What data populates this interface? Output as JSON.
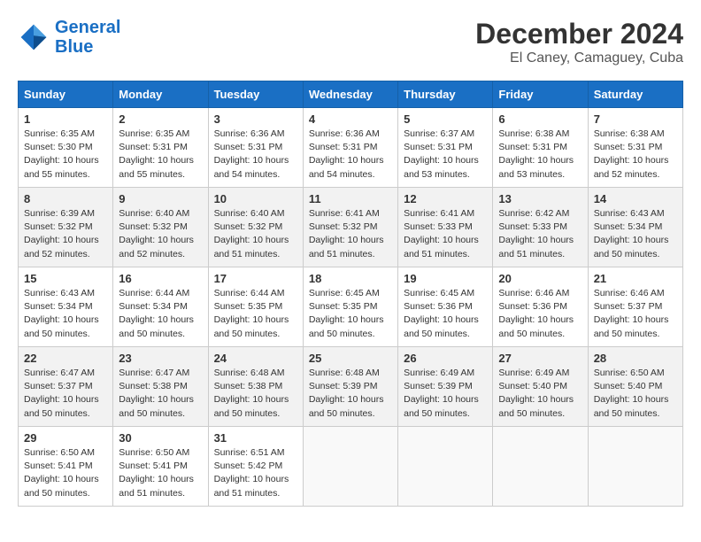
{
  "header": {
    "logo_line1": "General",
    "logo_line2": "Blue",
    "month": "December 2024",
    "location": "El Caney, Camaguey, Cuba"
  },
  "weekdays": [
    "Sunday",
    "Monday",
    "Tuesday",
    "Wednesday",
    "Thursday",
    "Friday",
    "Saturday"
  ],
  "weeks": [
    [
      {
        "day": 1,
        "rise": "6:35 AM",
        "set": "5:30 PM",
        "hours": "10 hours and 55 minutes."
      },
      {
        "day": 2,
        "rise": "6:35 AM",
        "set": "5:31 PM",
        "hours": "10 hours and 55 minutes."
      },
      {
        "day": 3,
        "rise": "6:36 AM",
        "set": "5:31 PM",
        "hours": "10 hours and 54 minutes."
      },
      {
        "day": 4,
        "rise": "6:36 AM",
        "set": "5:31 PM",
        "hours": "10 hours and 54 minutes."
      },
      {
        "day": 5,
        "rise": "6:37 AM",
        "set": "5:31 PM",
        "hours": "10 hours and 53 minutes."
      },
      {
        "day": 6,
        "rise": "6:38 AM",
        "set": "5:31 PM",
        "hours": "10 hours and 53 minutes."
      },
      {
        "day": 7,
        "rise": "6:38 AM",
        "set": "5:31 PM",
        "hours": "10 hours and 52 minutes."
      }
    ],
    [
      {
        "day": 8,
        "rise": "6:39 AM",
        "set": "5:32 PM",
        "hours": "10 hours and 52 minutes."
      },
      {
        "day": 9,
        "rise": "6:40 AM",
        "set": "5:32 PM",
        "hours": "10 hours and 52 minutes."
      },
      {
        "day": 10,
        "rise": "6:40 AM",
        "set": "5:32 PM",
        "hours": "10 hours and 51 minutes."
      },
      {
        "day": 11,
        "rise": "6:41 AM",
        "set": "5:32 PM",
        "hours": "10 hours and 51 minutes."
      },
      {
        "day": 12,
        "rise": "6:41 AM",
        "set": "5:33 PM",
        "hours": "10 hours and 51 minutes."
      },
      {
        "day": 13,
        "rise": "6:42 AM",
        "set": "5:33 PM",
        "hours": "10 hours and 51 minutes."
      },
      {
        "day": 14,
        "rise": "6:43 AM",
        "set": "5:34 PM",
        "hours": "10 hours and 50 minutes."
      }
    ],
    [
      {
        "day": 15,
        "rise": "6:43 AM",
        "set": "5:34 PM",
        "hours": "10 hours and 50 minutes."
      },
      {
        "day": 16,
        "rise": "6:44 AM",
        "set": "5:34 PM",
        "hours": "10 hours and 50 minutes."
      },
      {
        "day": 17,
        "rise": "6:44 AM",
        "set": "5:35 PM",
        "hours": "10 hours and 50 minutes."
      },
      {
        "day": 18,
        "rise": "6:45 AM",
        "set": "5:35 PM",
        "hours": "10 hours and 50 minutes."
      },
      {
        "day": 19,
        "rise": "6:45 AM",
        "set": "5:36 PM",
        "hours": "10 hours and 50 minutes."
      },
      {
        "day": 20,
        "rise": "6:46 AM",
        "set": "5:36 PM",
        "hours": "10 hours and 50 minutes."
      },
      {
        "day": 21,
        "rise": "6:46 AM",
        "set": "5:37 PM",
        "hours": "10 hours and 50 minutes."
      }
    ],
    [
      {
        "day": 22,
        "rise": "6:47 AM",
        "set": "5:37 PM",
        "hours": "10 hours and 50 minutes."
      },
      {
        "day": 23,
        "rise": "6:47 AM",
        "set": "5:38 PM",
        "hours": "10 hours and 50 minutes."
      },
      {
        "day": 24,
        "rise": "6:48 AM",
        "set": "5:38 PM",
        "hours": "10 hours and 50 minutes."
      },
      {
        "day": 25,
        "rise": "6:48 AM",
        "set": "5:39 PM",
        "hours": "10 hours and 50 minutes."
      },
      {
        "day": 26,
        "rise": "6:49 AM",
        "set": "5:39 PM",
        "hours": "10 hours and 50 minutes."
      },
      {
        "day": 27,
        "rise": "6:49 AM",
        "set": "5:40 PM",
        "hours": "10 hours and 50 minutes."
      },
      {
        "day": 28,
        "rise": "6:50 AM",
        "set": "5:40 PM",
        "hours": "10 hours and 50 minutes."
      }
    ],
    [
      {
        "day": 29,
        "rise": "6:50 AM",
        "set": "5:41 PM",
        "hours": "10 hours and 50 minutes."
      },
      {
        "day": 30,
        "rise": "6:50 AM",
        "set": "5:41 PM",
        "hours": "10 hours and 51 minutes."
      },
      {
        "day": 31,
        "rise": "6:51 AM",
        "set": "5:42 PM",
        "hours": "10 hours and 51 minutes."
      },
      null,
      null,
      null,
      null
    ]
  ]
}
